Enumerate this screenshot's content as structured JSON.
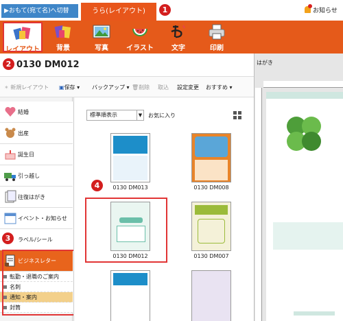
{
  "tabs": {
    "front": "▶おもて(宛て名)へ切替",
    "back": "うら(レイアウト)"
  },
  "notice": "お知らせ",
  "toolbar": [
    {
      "key": "layout",
      "label": "レイアウト",
      "icon": "layout-icon"
    },
    {
      "key": "background",
      "label": "背景",
      "icon": "background-icon"
    },
    {
      "key": "photo",
      "label": "写真",
      "icon": "photo-icon"
    },
    {
      "key": "illust",
      "label": "イラスト",
      "icon": "illustration-icon"
    },
    {
      "key": "text",
      "label": "文字",
      "icon": "text-icon"
    },
    {
      "key": "print",
      "label": "印刷",
      "icon": "printer-icon"
    }
  ],
  "doc_title": "0130 DM012",
  "preview_label": "はがき",
  "actions": {
    "new_layout": "新規レイアウト",
    "save": "保存",
    "backup": "バックアップ",
    "delete": "削除",
    "take": "取込",
    "settings": "設定変更",
    "recommend": "おすすめ"
  },
  "categories": [
    {
      "label": "結婚",
      "icon": "heart-icon",
      "color": "#e86f8a"
    },
    {
      "label": "出産",
      "icon": "bear-icon",
      "color": "#c98a4b"
    },
    {
      "label": "誕生日",
      "icon": "cake-icon",
      "color": "#f08a8a"
    },
    {
      "label": "引っ越し",
      "icon": "truck-icon",
      "color": "#4f9d4a"
    },
    {
      "label": "往復はがき",
      "icon": "postcard-icon",
      "color": "#9aa7b5"
    },
    {
      "label": "イベント・お知らせ",
      "icon": "calendar-icon",
      "color": "#5b8fd1"
    },
    {
      "label": "ラベル/シール",
      "icon": "label-icon",
      "color": "#b99cd8"
    },
    {
      "label": "ビジネスレター",
      "icon": "document-icon",
      "color": "#ffffff"
    }
  ],
  "subcategories": [
    {
      "label": "転勤・退職のご案内",
      "active": false
    },
    {
      "label": "名刺",
      "active": false
    },
    {
      "label": "通知・案内",
      "active": true
    },
    {
      "label": "封筒",
      "active": false
    }
  ],
  "sort": {
    "selected": "標準順表示"
  },
  "favorites": "お気に入り",
  "templates": [
    {
      "name": "0130 DM013",
      "color": "#1d8ec9"
    },
    {
      "name": "0130 DM008",
      "color": "#e8842a"
    },
    {
      "name": "0130 DM012",
      "color": "#6bbfa9"
    },
    {
      "name": "0130 DM007",
      "color": "#9bbb3a"
    }
  ],
  "badges": [
    "1",
    "2",
    "3",
    "4"
  ]
}
